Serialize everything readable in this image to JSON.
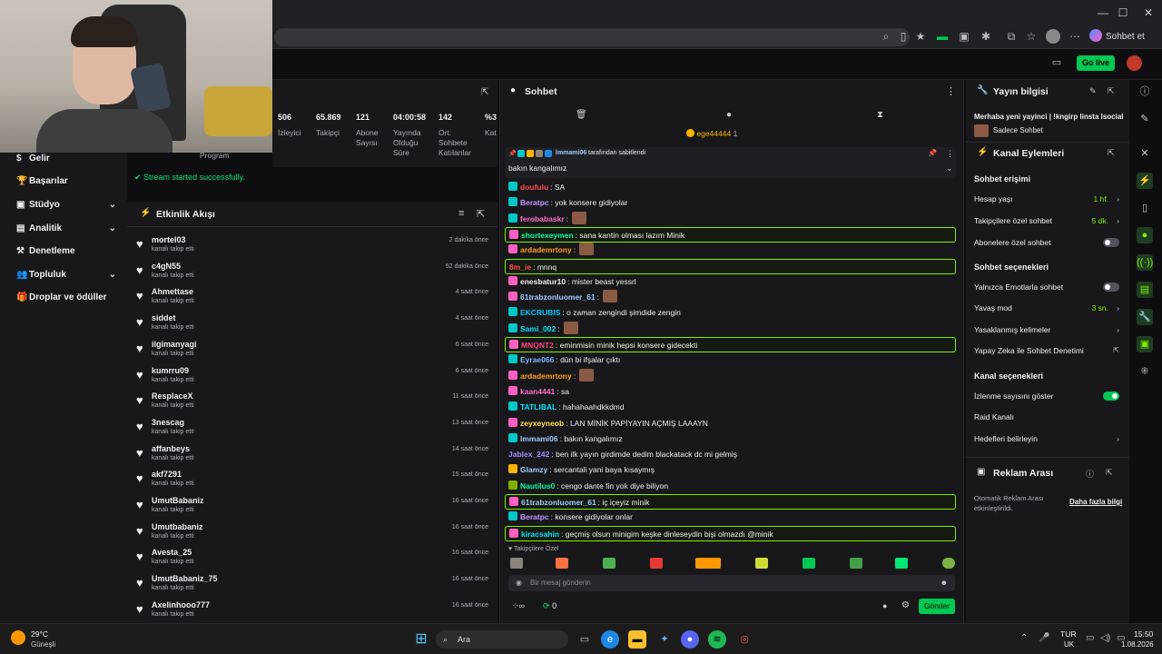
{
  "browser": {
    "sohbet_et": "Sohbet et",
    "window_controls": [
      "—",
      "☐",
      "✕"
    ]
  },
  "header": {
    "go_live": "Go live"
  },
  "nav": {
    "items": [
      {
        "label": "Gelir",
        "icon": "revenue-icon",
        "glyph": "$",
        "chevron": false
      },
      {
        "label": "Başarılar",
        "icon": "trophy-icon",
        "glyph": "🏆",
        "chevron": false
      },
      {
        "label": "Stüdyo",
        "icon": "studio-icon",
        "glyph": "▣",
        "chevron": true
      },
      {
        "label": "Analitik",
        "icon": "analytics-icon",
        "glyph": "▤",
        "chevron": true
      },
      {
        "label": "Denetleme",
        "icon": "moderation-icon",
        "glyph": "⚒",
        "chevron": false
      },
      {
        "label": "Topluluk",
        "icon": "community-icon",
        "glyph": "👥",
        "chevron": true
      },
      {
        "label": "Droplar ve ödüller",
        "icon": "drops-icon",
        "glyph": "🎁",
        "chevron": false
      }
    ]
  },
  "stats": {
    "program_label": "Program",
    "items": [
      {
        "value": "506",
        "label": "İzleyici"
      },
      {
        "value": "65.869",
        "label": "Takipçi"
      },
      {
        "value": "121",
        "label": "Abone Sayısı"
      },
      {
        "value": "04:00:58",
        "label": "Yayında Olduğu Süre"
      },
      {
        "value": "142",
        "label": "Ort. Sohbete Katılanlar"
      },
      {
        "value": "%3",
        "label": "Kat"
      }
    ]
  },
  "stream_status": "Stream started successfully.",
  "activity": {
    "title": "Etkinlik Akışı",
    "sub_label": "kanalı takip etti",
    "rows": [
      {
        "name": "mortel03",
        "time": "2 dakika önce"
      },
      {
        "name": "c4gN55",
        "time": "52 dakika önce"
      },
      {
        "name": "Ahmettase",
        "time": "4 saat önce"
      },
      {
        "name": "siddet",
        "time": "4 saat önce"
      },
      {
        "name": "ilgimanyagi",
        "time": "6 saat önce"
      },
      {
        "name": "kumrru09",
        "time": "6 saat önce"
      },
      {
        "name": "ResplaceX",
        "time": "11 saat önce"
      },
      {
        "name": "3nescag",
        "time": "13 saat önce"
      },
      {
        "name": "affanbeys",
        "time": "14 saat önce"
      },
      {
        "name": "akf7291",
        "time": "15 saat önce"
      },
      {
        "name": "UmutBabaniz",
        "time": "16 saat önce"
      },
      {
        "name": "Umutbabaniz",
        "time": "16 saat önce"
      },
      {
        "name": "Avesta_25",
        "time": "16 saat önce"
      },
      {
        "name": "UmutBabaniz_75",
        "time": "16 saat önce"
      },
      {
        "name": "Axelinhooo777",
        "time": "16 saat önce"
      }
    ]
  },
  "chat": {
    "title": "Sohbet",
    "leader": "ege44444",
    "leader_count": "1",
    "pinned_by": "lmmami06",
    "pinned_by_suffix": "tarafından sabitlendi",
    "pinned_text": "bakın kangalımız",
    "messages": [
      {
        "user": "doufulu",
        "text": "SA",
        "color": "#ff4f4f",
        "hl": false,
        "badge": "#00c8c8",
        "emote": false
      },
      {
        "user": "Beratpc",
        "text": "yok konsere gidiyolar",
        "color": "#bf94ff",
        "hl": false,
        "badge": "#00c8c8",
        "emote": false
      },
      {
        "user": "ferobabaskr",
        "text": "",
        "color": "#ff6ec7",
        "hl": false,
        "badge": "#00c8c8",
        "emote": true
      },
      {
        "user": "shortexeymen",
        "text": "sana kantin olması lazım Minik",
        "color": "#00ffa0",
        "hl": true,
        "badge": "#ff5ec4",
        "emote": false
      },
      {
        "user": "ardademrtony",
        "text": "",
        "color": "#ff9f1a",
        "hl": false,
        "badge": "#ff5ec4",
        "emote": true
      },
      {
        "user": "8m_ie",
        "text": "mnnq",
        "color": "#ff4f4f",
        "hl": true,
        "badge": "",
        "emote": false
      },
      {
        "user": "enesbatur10",
        "text": "mister beast yessrl",
        "color": "#efeff1",
        "hl": false,
        "badge": "#ff5ec4",
        "emote": false
      },
      {
        "user": "61trabzonluomer_61",
        "text": "",
        "color": "#9ecbff",
        "hl": false,
        "badge": "#ff5ec4",
        "emote": true
      },
      {
        "user": "EKCRUBIS",
        "text": "o zaman zengindi şimdide zengin",
        "color": "#00c8ff",
        "hl": false,
        "badge": "#00c8c8",
        "emote": false
      },
      {
        "user": "Sami_002",
        "text": "",
        "color": "#00e5ff",
        "hl": false,
        "badge": "#00c8c8",
        "emote": true
      },
      {
        "user": "MNQNT2",
        "text": "eminmisin minik hepsi konsere gidecekti",
        "color": "#ff3f8f",
        "hl": true,
        "badge": "#ff5ec4",
        "emote": false
      },
      {
        "user": "Eyrae066",
        "text": "dün bi ifşalar çıktı",
        "color": "#7fb2ff",
        "hl": false,
        "badge": "#00c8c8",
        "emote": false
      },
      {
        "user": "ardademrtony",
        "text": "",
        "color": "#ff9f1a",
        "hl": false,
        "badge": "#ff5ec4",
        "emote": true
      },
      {
        "user": "kaan4441",
        "text": "sa",
        "color": "#ff6ec7",
        "hl": false,
        "badge": "#ff5ec4",
        "emote": false
      },
      {
        "user": "TATLIBAL",
        "text": "hahahaahdkkdmd",
        "color": "#00e5ff",
        "hl": false,
        "badge": "#00c8c8",
        "emote": false
      },
      {
        "user": "zeyxeyneob",
        "text": "LAN MİNİK PAPİYAYIN AÇMIŞ LAAAYN",
        "color": "#ffe14f",
        "hl": false,
        "badge": "#ff5ec4",
        "emote": false
      },
      {
        "user": "lmmami06",
        "text": "bakın kangalımız",
        "color": "#9ecbff",
        "hl": false,
        "badge": "#00c8c8",
        "emote": false
      },
      {
        "user": "Jablex_242",
        "text": "ben ilk yayın girdimde dedim blackatack dc mi gelmiş",
        "color": "#9f8fff",
        "hl": false,
        "badge": "",
        "emote": false
      },
      {
        "user": "Glamzy",
        "text": "sercantali yani baya kısaymış",
        "color": "#9ecbff",
        "hl": false,
        "badge": "#ffb300",
        "emote": false
      },
      {
        "user": "Nautilus0",
        "text": "cengo dante fin yok diye biliyon",
        "color": "#00ffa0",
        "hl": false,
        "badge": "#7fb000",
        "emote": false
      },
      {
        "user": "61trabzonluomer_61",
        "text": "iç içeyiz minik",
        "color": "#9ecbff",
        "hl": true,
        "badge": "#ff5ec4",
        "emote": false
      },
      {
        "user": "Beratpc",
        "text": "konsere gidiyolar onlar",
        "color": "#bf94ff",
        "hl": false,
        "badge": "#00c8c8",
        "emote": false
      },
      {
        "user": "kiracsahin",
        "text": "geçmiş olsun minigim keşke dinleseydin bişi olmazdı @minik",
        "color": "#00e5ff",
        "hl": true,
        "badge": "#ff5ec4",
        "emote": false
      }
    ],
    "followers_only": "Takipçilere Özel",
    "input_placeholder": "Bir mesaj gönderin",
    "points": "0",
    "send": "Gönder"
  },
  "stream_info": {
    "title": "Yayın bilgisi",
    "stream_title": "Merhaba yeni yayinci | !kngirp linsta Isocial",
    "category": "Sadece Sohbet"
  },
  "channel_actions": {
    "title": "Kanal Eylemleri",
    "chat_access": "Sohbet erişimi",
    "account_age": {
      "label": "Hesap yaşı",
      "value": "1 hf."
    },
    "followers_chat": {
      "label": "Takipçilere özel sohbet",
      "value": "5 dk."
    },
    "subs_chat": {
      "label": "Abonelere özel sohbet",
      "on": false
    },
    "chat_options": "Sohbet seçenekleri",
    "emote_only": {
      "label": "Yalnızca Emotlarla sohbet",
      "on": false
    },
    "slow_mode": {
      "label": "Yavaş mod",
      "value": "3 sn."
    },
    "banned_words": "Yasaklanmış kelimeler",
    "ai_moderation": "Yapay Zeka ile Sohbet Denetimi",
    "channel_options": "Kanal seçenekleri",
    "show_viewcount": {
      "label": "İzlenme sayısını göster",
      "on": true
    },
    "raid": "Raid Kanalı",
    "goals": "Hedefleri belirleyin"
  },
  "ads": {
    "title": "Reklam Arası",
    "desc": "Otomatik Reklam Arası etkinleştirildi.",
    "more": "Daha fazla bilgi"
  },
  "taskbar": {
    "temp": "29°C",
    "weather": "Güneşli",
    "search": "Ara",
    "lang1": "TUR",
    "lang2": "UK",
    "time": "15:50",
    "date": "1.08.2026"
  },
  "colors": {
    "accent": "#00c853",
    "highlight": "#7ff000",
    "bg": "#0e0e10",
    "panel": "#18181b"
  }
}
